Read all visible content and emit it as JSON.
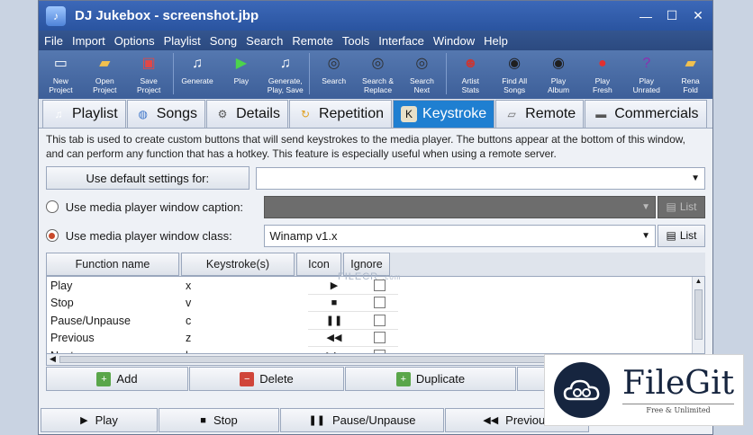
{
  "window": {
    "title": "DJ Jukebox - screenshot.jbp",
    "controls": {
      "minimize": "—",
      "maximize": "☐",
      "close": "✕"
    }
  },
  "menu": [
    "File",
    "Import",
    "Options",
    "Playlist",
    "Song",
    "Search",
    "Remote",
    "Tools",
    "Interface",
    "Window",
    "Help"
  ],
  "toolbar": [
    {
      "name": "new-project",
      "label": "New\nProject",
      "icon": "page-icon"
    },
    {
      "name": "open-project",
      "label": "Open\nProject",
      "icon": "folder-icon"
    },
    {
      "name": "save-project",
      "label": "Save\nProject",
      "icon": "disk-icon"
    },
    {
      "sep": true
    },
    {
      "name": "generate",
      "label": "Generate",
      "icon": "music-doc-icon"
    },
    {
      "name": "play",
      "label": "Play",
      "icon": "play-doc-icon"
    },
    {
      "name": "generate-play-save",
      "label": "Generate,\nPlay, Save",
      "icon": "music-doc-icon"
    },
    {
      "sep": true
    },
    {
      "name": "search",
      "label": "Search",
      "icon": "binoculars-icon"
    },
    {
      "name": "search-replace",
      "label": "Search &\nReplace",
      "icon": "binoculars-icon"
    },
    {
      "name": "search-next",
      "label": "Search\nNext",
      "icon": "binoculars-icon"
    },
    {
      "sep": true
    },
    {
      "name": "artist-stats",
      "label": "Artist\nStats",
      "icon": "person-icon"
    },
    {
      "name": "find-all-songs",
      "label": "Find All\nSongs",
      "icon": "disc-icon"
    },
    {
      "name": "play-album",
      "label": "Play\nAlbum",
      "icon": "disc-icon"
    },
    {
      "name": "play-fresh",
      "label": "Play\nFresh",
      "icon": "apple-icon"
    },
    {
      "name": "play-unrated",
      "label": "Play\nUnrated",
      "icon": "question-icon"
    },
    {
      "name": "rename-folder",
      "label": "Rena\nFold",
      "icon": "folder-icon"
    }
  ],
  "tabs": [
    {
      "label": "Playlist",
      "icon": "music-doc-icon",
      "active": false
    },
    {
      "label": "Songs",
      "icon": "globe-icon",
      "active": false
    },
    {
      "label": "Details",
      "icon": "gear-icon",
      "active": false
    },
    {
      "label": "Repetition",
      "icon": "repeat-icon",
      "active": false
    },
    {
      "label": "Keystroke",
      "icon": "key-icon",
      "active": true
    },
    {
      "label": "Remote",
      "icon": "remote-icon",
      "active": false
    },
    {
      "label": "Commercials",
      "icon": "tv-icon",
      "active": false
    }
  ],
  "description": "This tab is used to create custom buttons that will send keystrokes to the media player.  The buttons appear at the bottom of this window, and can perform any function that has a hotkey.  This feature is especially useful when using a remote server.",
  "settings": {
    "default_button": "Use default settings for:",
    "default_value": "",
    "caption_label": "Use media player window caption:",
    "caption_value": "",
    "caption_list": "List",
    "class_label": "Use media player window class:",
    "class_value": "Winamp v1.x",
    "class_list": "List"
  },
  "grid": {
    "headers": [
      "Function name",
      "Keystroke(s)",
      "Icon",
      "Ignore"
    ],
    "rows": [
      {
        "name": "Play",
        "key": "x",
        "icon": "▶"
      },
      {
        "name": "Stop",
        "key": "v",
        "icon": "■"
      },
      {
        "name": "Pause/Unpause",
        "key": "c",
        "icon": "❚❚"
      },
      {
        "name": "Previous",
        "key": "z",
        "icon": "◀◀"
      },
      {
        "name": "Next",
        "key": "b",
        "icon": "▶▶"
      }
    ]
  },
  "actions": {
    "add": "Add",
    "delete": "Delete",
    "duplicate": "Duplicate"
  },
  "bottom_buttons": [
    {
      "sym": "▶",
      "label": "Play"
    },
    {
      "sym": "■",
      "label": "Stop"
    },
    {
      "sym": "❚❚",
      "label": "Pause/Unpause"
    },
    {
      "sym": "◀◀",
      "label": "Previous"
    }
  ],
  "watermark": {
    "small": "FILECR",
    "small_suffix": ".com",
    "brand": "FileGit",
    "tagline": "Free & Unlimited"
  }
}
